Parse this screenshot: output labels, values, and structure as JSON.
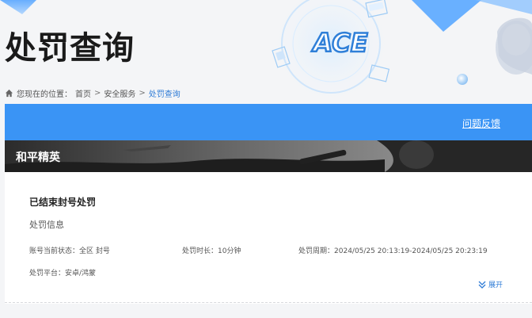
{
  "page": {
    "title": "处罚查询"
  },
  "breadcrumb": {
    "prefix": "您现在的位置：",
    "items": [
      "首页",
      "安全服务",
      "处罚查询"
    ],
    "separator": ">"
  },
  "banner": {
    "feedback_label": "问题反馈"
  },
  "game": {
    "name": "和平精英"
  },
  "record": {
    "title": "已结束封号处罚",
    "section_label": "处罚信息",
    "status_label": "账号当前状态：",
    "status_value": "全区 封号",
    "duration_label": "处罚时长：",
    "duration_value": "10分钟",
    "period_label": "处罚周期：",
    "period_value": "2024/05/25 20:13:19-2024/05/25 20:23:19",
    "platform_label": "处罚平台：",
    "platform_value": "安卓/鸿蒙",
    "expand_label": "展开"
  },
  "logo": {
    "text": "ACE"
  },
  "colors": {
    "accent": "#3a94f5",
    "link": "#2e7bd6",
    "background": "#f4f5f7"
  },
  "icons": [
    "home-icon",
    "chevron-double-down-icon",
    "ace-logo"
  ]
}
